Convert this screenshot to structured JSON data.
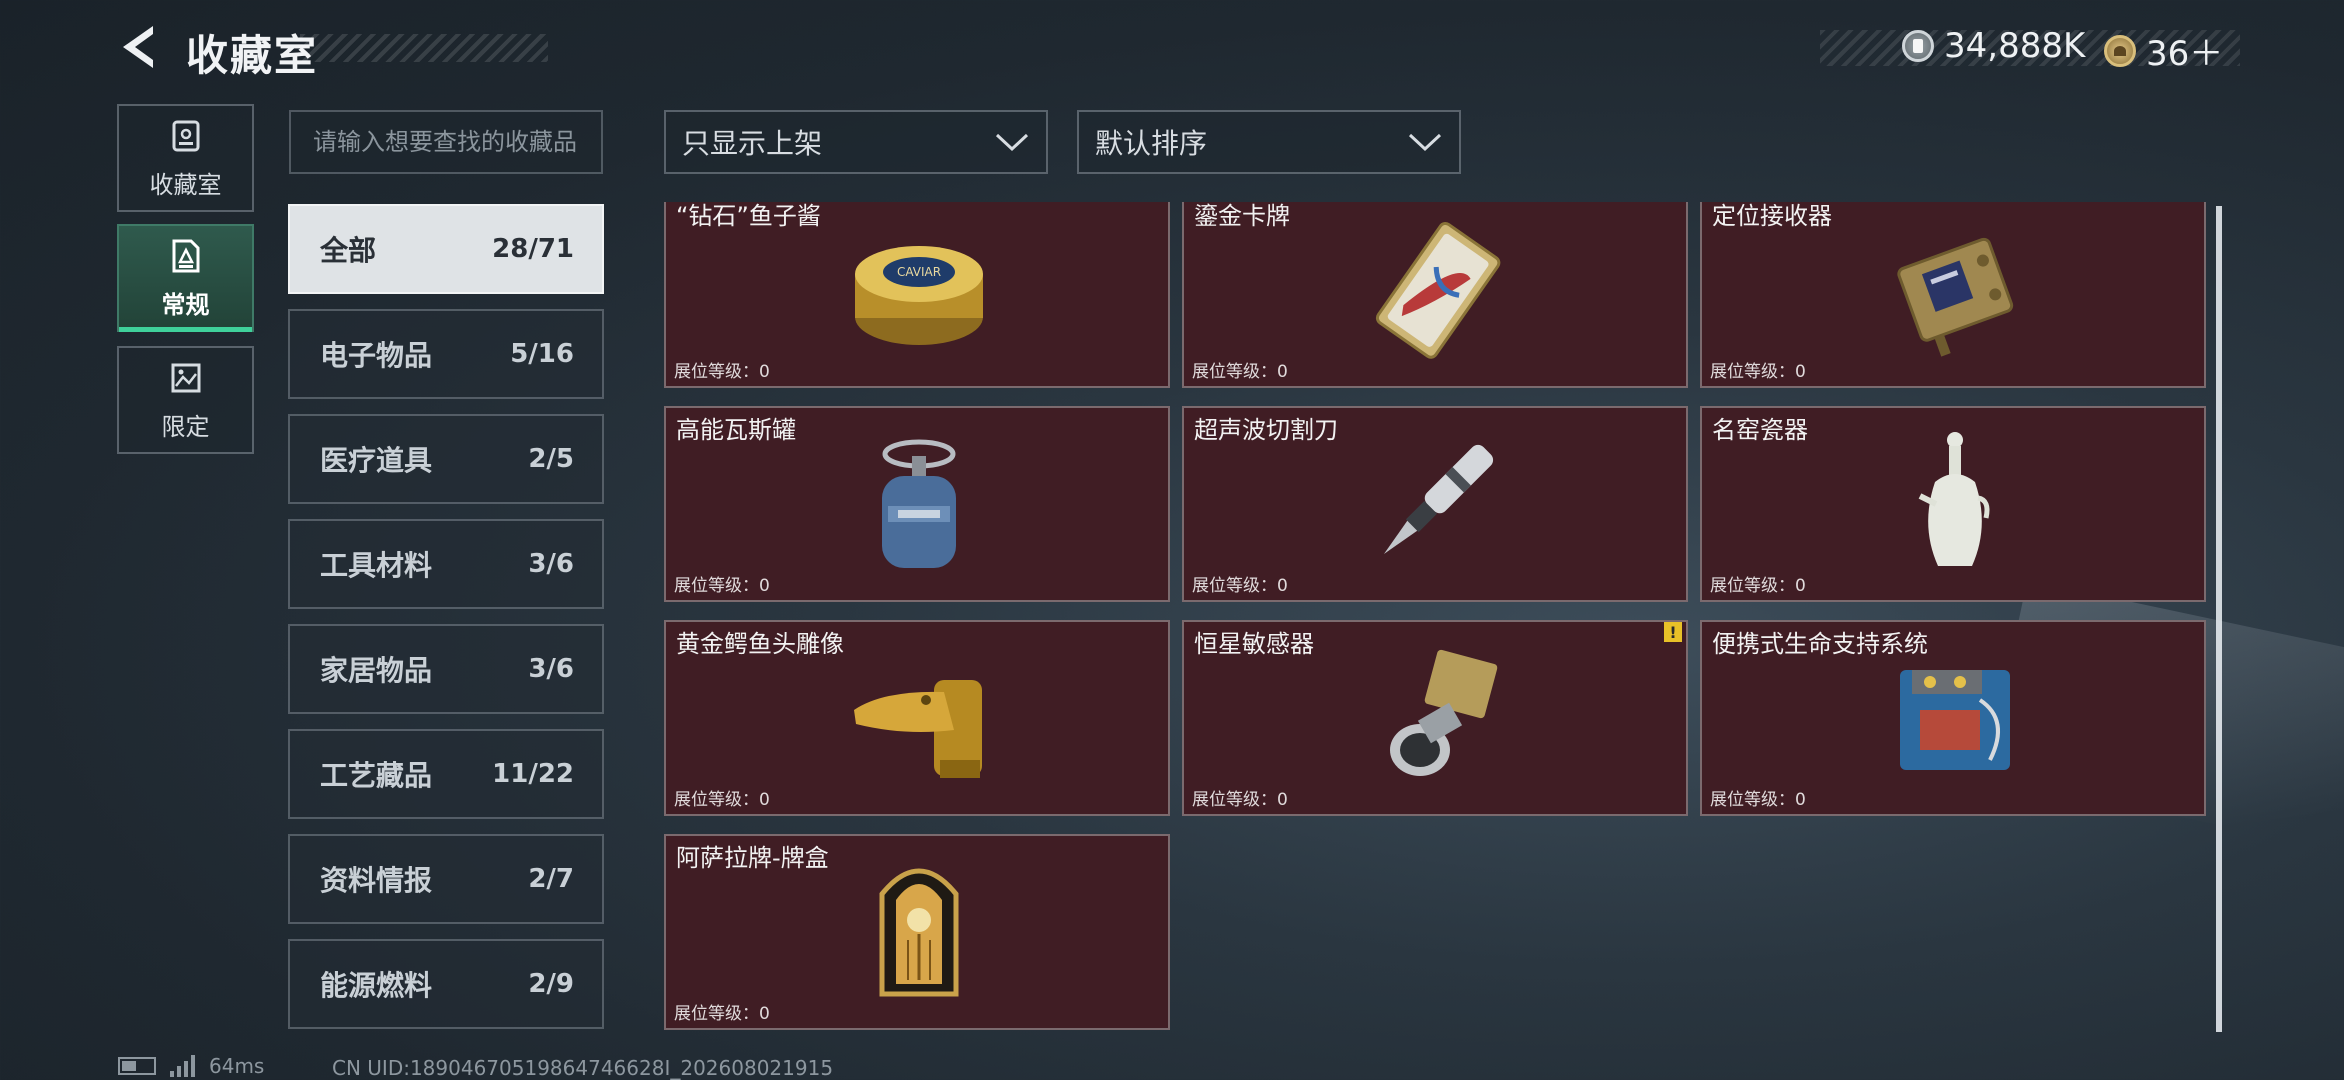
{
  "header": {
    "title": "收藏室",
    "back_icon": "chevron-left-icon",
    "currencies": [
      {
        "icon": "silver-coin-icon",
        "value": "34,888K"
      },
      {
        "icon": "gold-token-icon",
        "value": "36＋"
      }
    ]
  },
  "side_tabs": [
    {
      "label": "收藏室",
      "icon": "vault-icon",
      "active": false
    },
    {
      "label": "常规",
      "icon": "document-icon",
      "active": true
    },
    {
      "label": "限定",
      "icon": "image-icon",
      "active": false
    }
  ],
  "search": {
    "placeholder": "请输入想要查找的收藏品",
    "value": ""
  },
  "filters": {
    "display": "只显示上架",
    "sort": "默认排序"
  },
  "categories": [
    {
      "label": "全部",
      "count": "28/71",
      "active": true
    },
    {
      "label": "电子物品",
      "count": "5/16"
    },
    {
      "label": "医疗道具",
      "count": "2/5"
    },
    {
      "label": "工具材料",
      "count": "3/6"
    },
    {
      "label": "家居物品",
      "count": "3/6"
    },
    {
      "label": "工艺藏品",
      "count": "11/22"
    },
    {
      "label": "资料情报",
      "count": "2/7"
    },
    {
      "label": "能源燃料",
      "count": "2/9"
    }
  ],
  "items": [
    {
      "name": "“钻石”鱼子酱",
      "level": "展位等级：0",
      "icon": "caviar-tin-icon"
    },
    {
      "name": "鎏金卡牌",
      "level": "展位等级：0",
      "icon": "gilded-card-icon"
    },
    {
      "name": "定位接收器",
      "level": "展位等级：0",
      "icon": "receiver-icon"
    },
    {
      "name": "高能瓦斯罐",
      "level": "展位等级：0",
      "icon": "gas-canister-icon"
    },
    {
      "name": "超声波切割刀",
      "level": "展位等级：0",
      "icon": "ultrasonic-knife-icon"
    },
    {
      "name": "名窑瓷器",
      "level": "展位等级：0",
      "icon": "porcelain-vase-icon"
    },
    {
      "name": "黄金鳄鱼头雕像",
      "level": "展位等级：0",
      "icon": "gold-crocodile-icon"
    },
    {
      "name": "恒星敏感器",
      "level": "展位等级：0",
      "icon": "star-sensor-icon",
      "warning": "!"
    },
    {
      "name": "便携式生命支持系统",
      "level": "展位等级：0",
      "icon": "life-support-icon"
    },
    {
      "name": "阿萨拉牌-牌盒",
      "level": "展位等级：0",
      "icon": "card-box-icon"
    }
  ],
  "footer": {
    "ping": "64ms",
    "uid": "CN UID:18904670519864746628I_202608021915"
  }
}
